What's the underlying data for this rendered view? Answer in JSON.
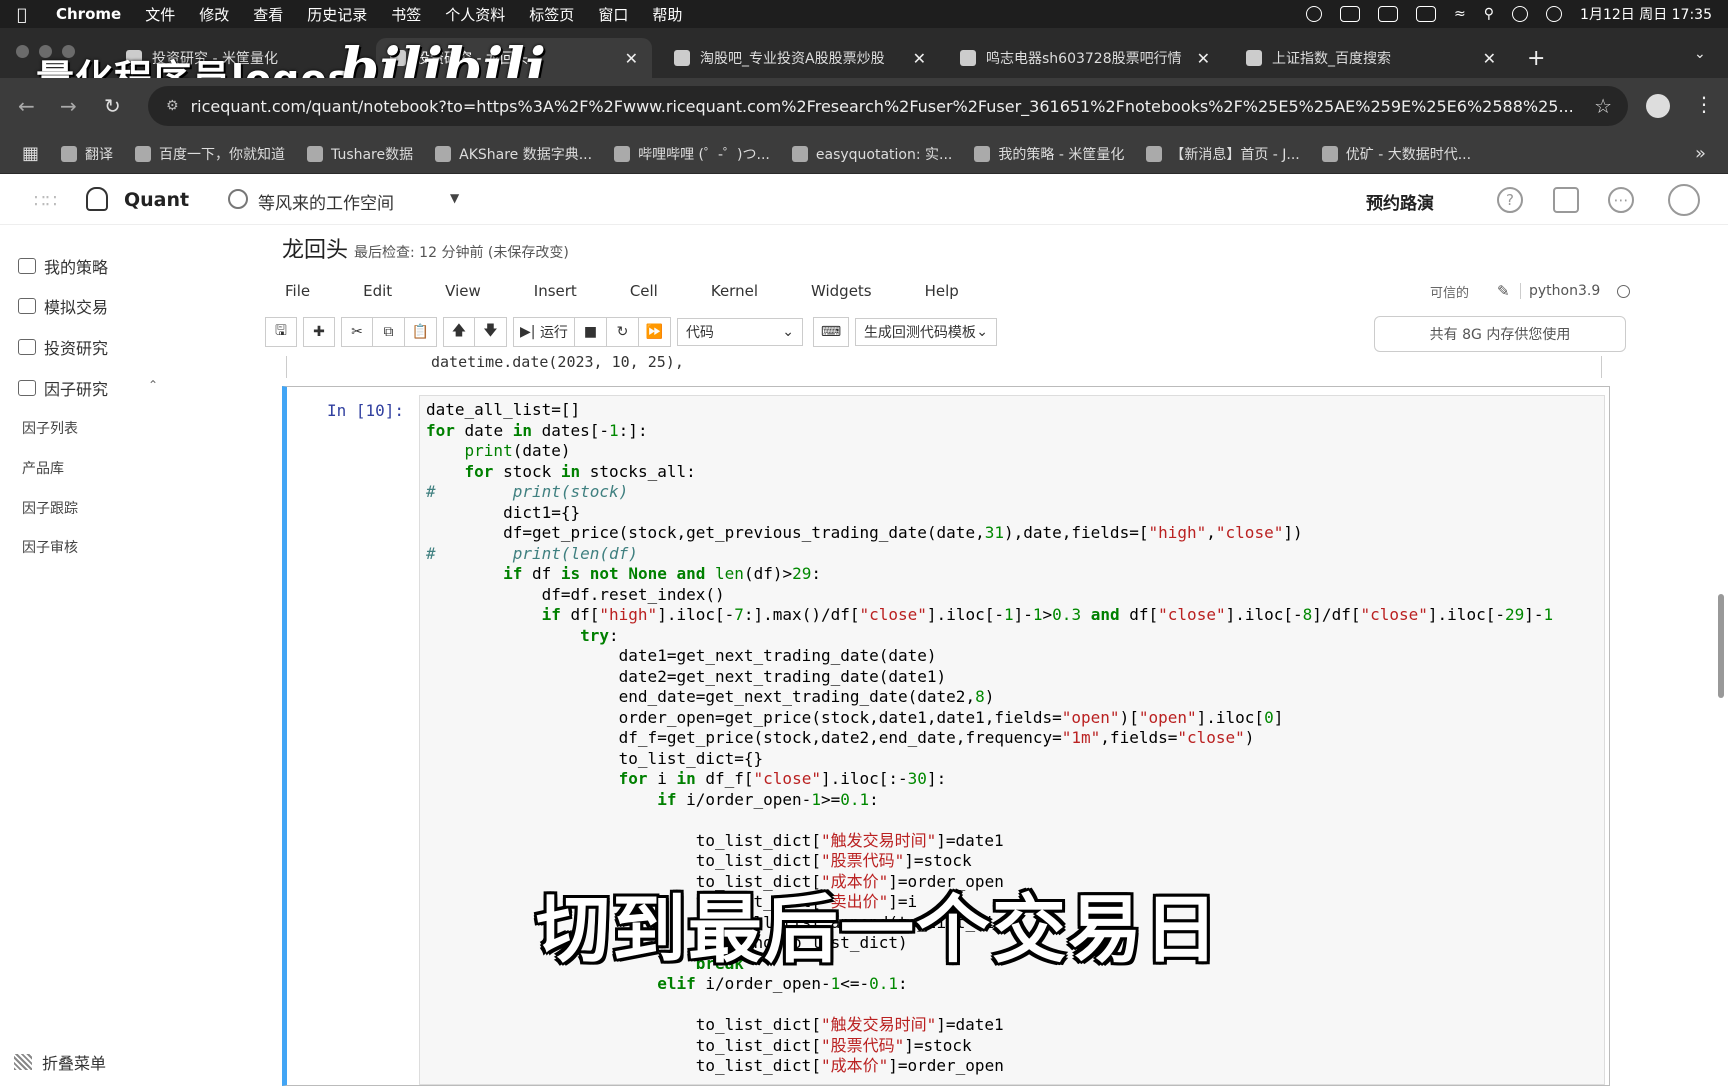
{
  "menubar": {
    "app": "Chrome",
    "items": [
      "文件",
      "修改",
      "查看",
      "历史记录",
      "书签",
      "个人资料",
      "标签页",
      "窗口",
      "帮助"
    ],
    "clock": "1月12日 周日 17:35"
  },
  "tabs": [
    {
      "title": "投资研究 - 米筐量化",
      "active": false
    },
    {
      "title": "投资研究 - 龙回头",
      "active": true
    },
    {
      "title": "淘股吧_专业投资A股股票炒股",
      "active": false
    },
    {
      "title": "鸣志电器sh603728股票吧行情",
      "active": false
    },
    {
      "title": "上证指数_百度搜索",
      "active": false
    }
  ],
  "address": {
    "url": "ricequant.com/quant/notebook?to=https%3A%2F%2Fwww.ricequant.com%2Fresearch%2Fuser%2Fuser_361651%2Fnotebooks%2F%25E5%25AE%259E%25E6%2588%25..."
  },
  "bookmarks": [
    "翻译",
    "百度一下，你就知道",
    "Tushare数据",
    "AKShare 数据字典...",
    "哔哩哔哩 (゜-゜)つ...",
    "easyquotation: 实...",
    "我的策略 - 米筐量化",
    "【新消息】首页 - J...",
    "优矿 - 大数据时代..."
  ],
  "watermark": {
    "text": "量化程序员logos",
    "logo": "bilibili"
  },
  "header": {
    "brand": "Quant",
    "workspace": "等风来的工作空间",
    "roadshow": "预约路演"
  },
  "sidebar": {
    "items": [
      "我的策略",
      "模拟交易",
      "投资研究",
      "因子研究"
    ],
    "subitems": [
      "因子列表",
      "产品库",
      "因子跟踪",
      "因子审核"
    ],
    "fold": "折叠菜单"
  },
  "notebook": {
    "title": "龙回头",
    "checkpoint": "最后检查: 12 分钟前  (未保存改变)",
    "menus": [
      "File",
      "Edit",
      "View",
      "Insert",
      "Cell",
      "Kernel",
      "Widgets",
      "Help"
    ],
    "trusted": "可信的",
    "kernel": "python3.9",
    "run_label": "运行",
    "cell_type": "代码",
    "template_label": "生成回测代码模板",
    "memory": "共有 8G 内存供您使用",
    "prev_cell_text": "datetime.date(2023, 10, 25),",
    "prompt": "In [10]:"
  },
  "code_lines": [
    "date_all_list=[]",
    "for date in dates[-1:]:",
    "    print(date)",
    "    for stock in stocks_all:",
    "#        print(stock)",
    "        dict1={}",
    "        df=get_price(stock,get_previous_trading_date(date,31),date,fields=[\"high\",\"close\"])",
    "#        print(len(df)",
    "        if df is not None and len(df)>29:",
    "            df=df.reset_index()",
    "            if df[\"high\"].iloc[-7:].max()/df[\"close\"].iloc[-1]-1>0.3 and df[\"close\"].iloc[-8]/df[\"close\"].iloc[-29]-1",
    "                try:",
    "                    date1=get_next_trading_date(date)",
    "                    date2=get_next_trading_date(date1)",
    "                    end_date=get_next_trading_date(date2,8)",
    "                    order_open=get_price(stock,date1,date1,fields=\"open\")[\"open\"].iloc[0]",
    "                    df_f=get_price(stock,date2,end_date,frequency=\"1m\",fields=\"close\")",
    "                    to_list_dict={}",
    "                    for i in df_f[\"close\"].iloc[:-30]:",
    "                        if i/order_open-1>=0.1:",
    "",
    "                            to_list_dict[\"触发交易时间\"]=date1",
    "                            to_list_dict[\"股票代码\"]=stock",
    "                            to_list_dict[\"成本价\"]=order_open",
    "                            to_list_dict[\"卖出价\"]=i",
    "                            date_all_list.append(to_list_dict)",
    "                            t.append(to_list_dict)",
    "                            break",
    "                        elif i/order_open-1<=-0.1:",
    "",
    "                            to_list_dict[\"触发交易时间\"]=date1",
    "                            to_list_dict[\"股票代码\"]=stock",
    "                            to_list_dict[\"成本价\"]=order_open"
  ],
  "subtitle": "切到最后一个交易日"
}
